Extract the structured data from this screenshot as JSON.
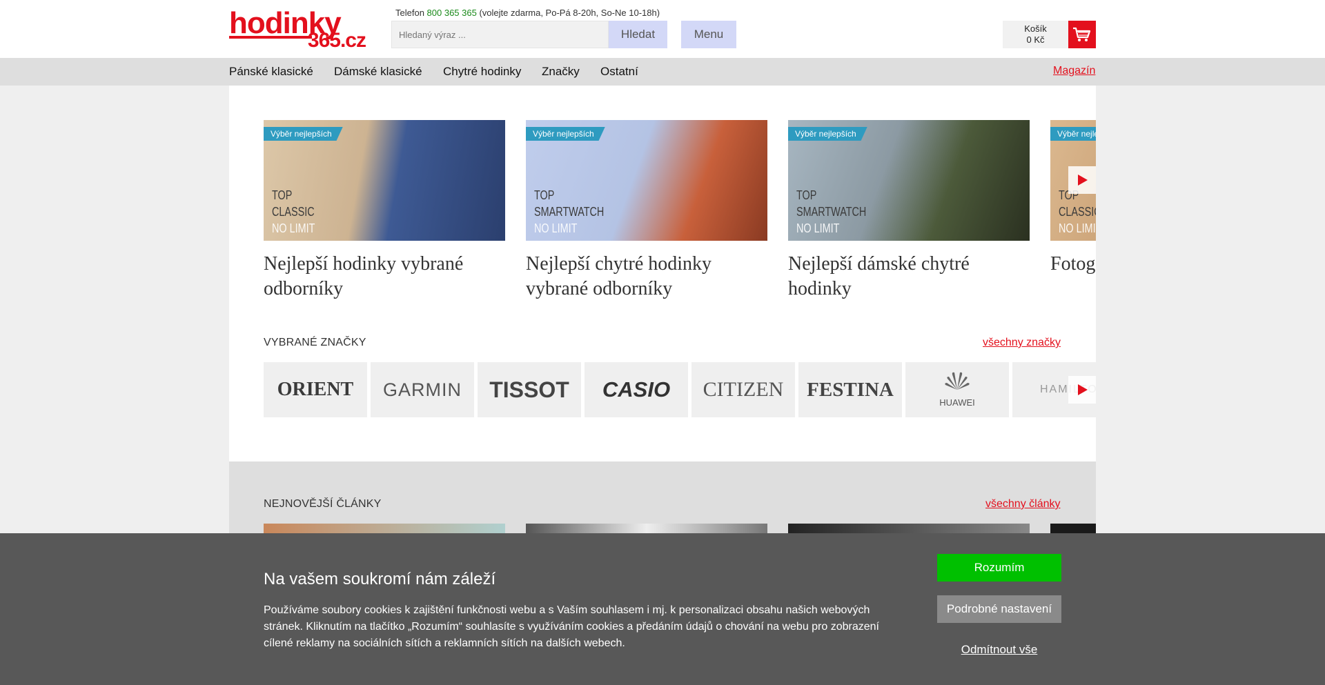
{
  "header": {
    "logo_top": "hodinky",
    "logo_bottom": "365.cz",
    "phone_prefix": "Telefon",
    "phone_number": "800 365 365",
    "phone_hours": "(volejte zdarma, Po-Pá 8-20h, So-Ne 10-18h)",
    "search_placeholder": "Hledaný výraz ...",
    "search_button": "Hledat",
    "menu_button": "Menu",
    "cart_label": "Košík",
    "cart_total": "0 Kč"
  },
  "nav": {
    "items": [
      "Pánské klasické",
      "Dámské klasické",
      "Chytré hodinky",
      "Značky",
      "Ostatní"
    ],
    "magazine": "Magazín"
  },
  "featured": [
    {
      "badge": "Výběr nejlepších",
      "img_line1": "TOP",
      "img_line2": "CLASSIC",
      "img_line3": "NO LIMIT",
      "title": "Nejlepší hodinky vybrané odborníky",
      "colors": [
        "#d8c3a5",
        "#4f6fa8"
      ]
    },
    {
      "badge": "Výběr nejlepších",
      "img_line1": "TOP",
      "img_line2": "SMARTWATCH",
      "img_line3": "NO LIMIT",
      "title": "Nejlepší chytré hodinky vybrané odborníky",
      "colors": [
        "#b7c6e6",
        "#b8583a"
      ]
    },
    {
      "badge": "Výběr nejlepších",
      "img_line1": "TOP",
      "img_line2": "SMARTWATCH",
      "img_line3": "NO LIMIT",
      "title": "Nejlepší dámské chytré hodinky",
      "colors": [
        "#9fb0bb",
        "#3b4a2e"
      ]
    },
    {
      "badge": "Výběr nejlepších",
      "img_line1": "TOP",
      "img_line2": "CLASSIC",
      "img_line3": "NO LIMIT",
      "title": "Fotogalerie dámské",
      "colors": [
        "#d9b48a",
        "#a87850"
      ]
    }
  ],
  "brands": {
    "heading": "VYBRANÉ ZNAČKY",
    "link": "všechny značky",
    "items": [
      "ORIENT",
      "GARMIN",
      "TISSOT",
      "CASIO",
      "CITIZEN",
      "FESTINA",
      "HUAWEI",
      "HAMILTON"
    ]
  },
  "articles": {
    "heading": "NEJNOVĚJŠÍ ČLÁNKY",
    "link": "všechny články"
  },
  "cookie": {
    "title": "Na vašem soukromí nám záleží",
    "text": "Používáme soubory cookies k zajištění funkčnosti webu a s Vaším souhlasem i mj. k personalizaci obsahu našich webových stránek. Kliknutím na tlačítko „Rozumím“ souhlasíte s využíváním cookies a předáním údajů o chování na webu pro zobrazení cílené reklamy na sociálních sítích a reklamních sítích na dalších webech.",
    "accept": "Rozumím",
    "settings": "Podrobné nastavení",
    "reject": "Odmítnout vše"
  },
  "colors": {
    "brand_red": "#e3101d",
    "accept_green": "#00c000",
    "badge_blue": "#2e9bc0"
  }
}
